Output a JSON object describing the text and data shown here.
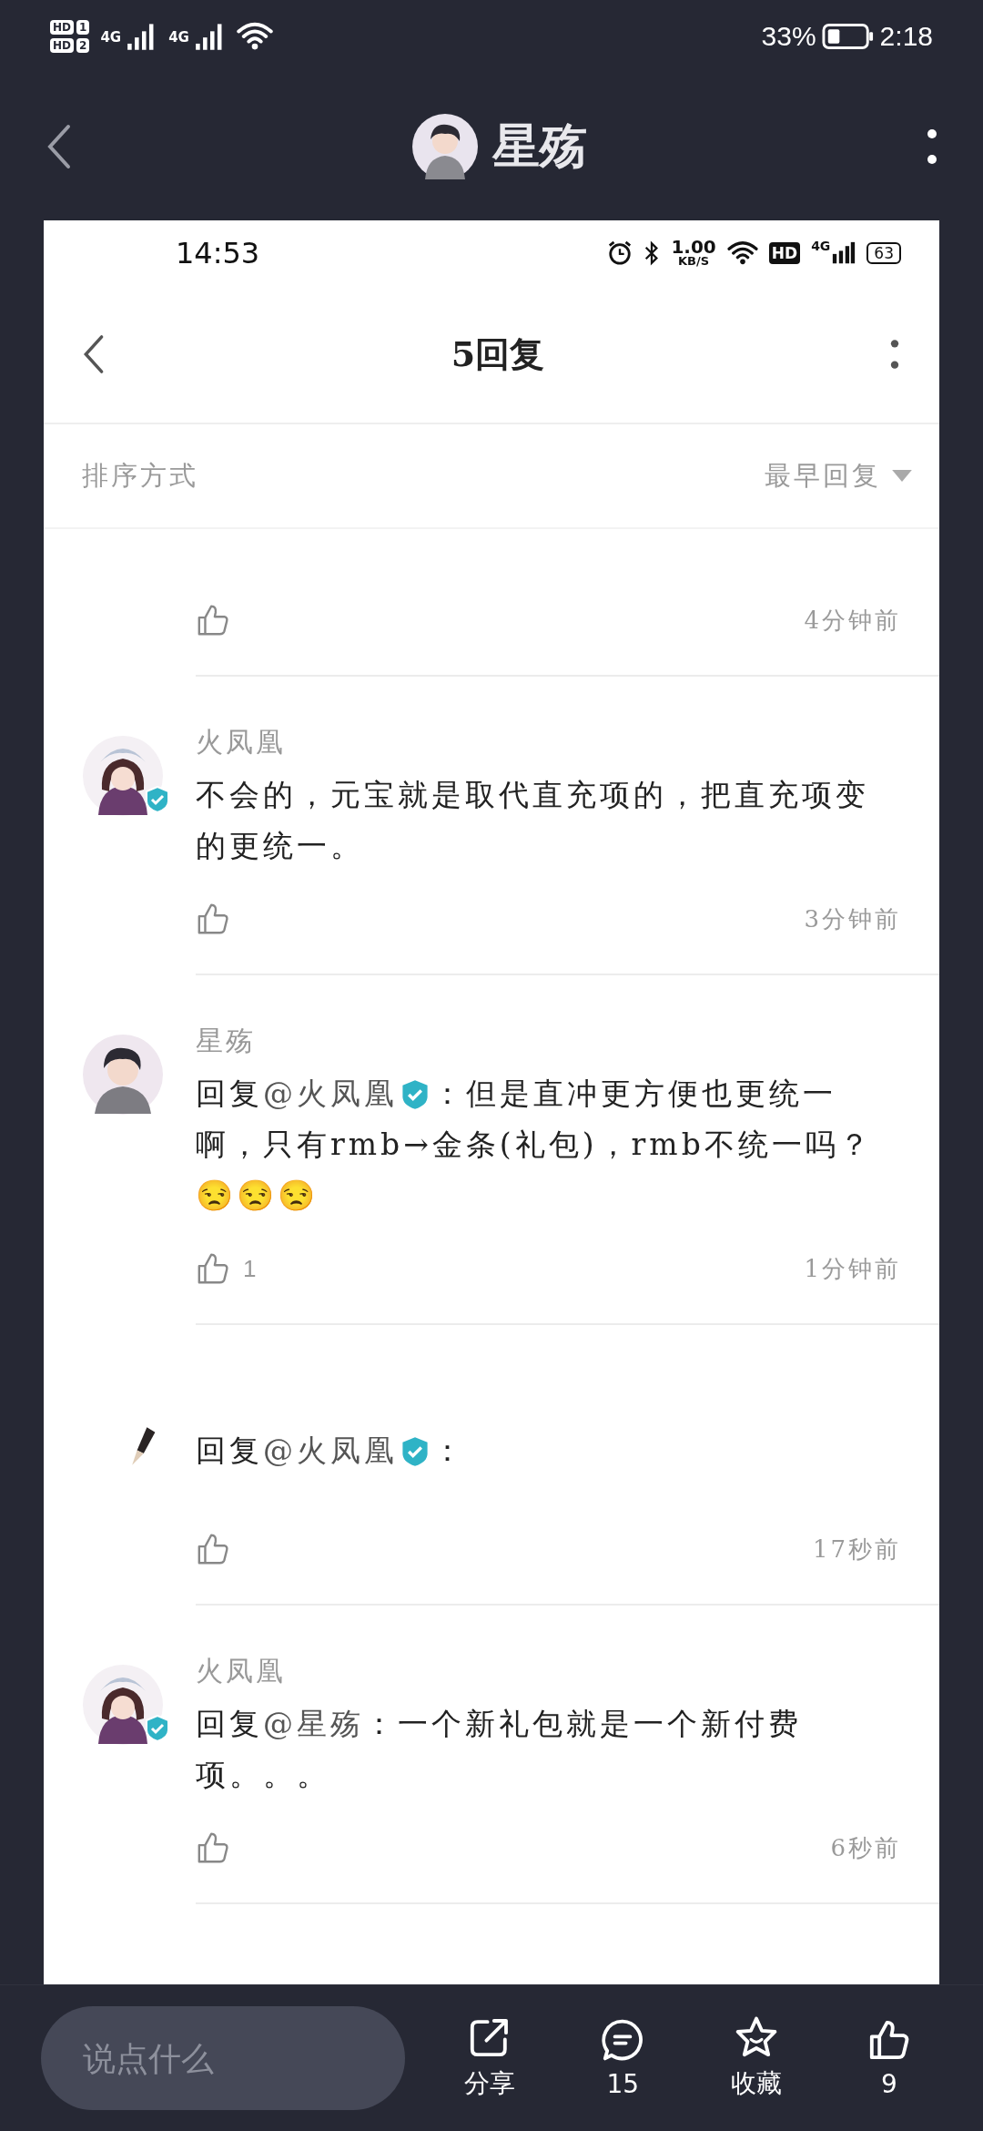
{
  "status_bar": {
    "hd_badges": [
      {
        "label": "HD",
        "sim": "1"
      },
      {
        "label": "HD",
        "sim": "2"
      }
    ],
    "networks": [
      "4G",
      "4G"
    ],
    "battery": "33%",
    "time": "2:18"
  },
  "chat_header": {
    "title": "星殇"
  },
  "shared_screenshot": {
    "status_bar": {
      "time": "14:53",
      "speed": "1.00",
      "speed_unit": "KB/S",
      "hd": "HD",
      "network": "4G",
      "battery": "63"
    },
    "nav": {
      "title": "5回复"
    },
    "sort": {
      "label": "排序方式",
      "value": "最早回复"
    },
    "comments": [
      {
        "time": "4分钟前"
      },
      {
        "avatar": {
          "kind": "girl",
          "verified": true
        },
        "name": "火凤凰",
        "text": "不会的，元宝就是取代直充项的，把直充项变的更统一。",
        "time": "3分钟前"
      },
      {
        "avatar": {
          "kind": "boy"
        },
        "name": "星殇",
        "reply_to": {
          "prefix": "回复",
          "mention": "@火凤凰",
          "verified": true
        },
        "text": "：但是直冲更方便也更统一啊，只有rmb→金条(礼包)，rmb不统一吗？😒😒😒",
        "likes": "1",
        "time": "1分钟前"
      },
      {
        "avatar": {
          "kind": "pen"
        },
        "reply_to": {
          "prefix": "回复",
          "mention": "@火凤凰",
          "verified": true
        },
        "text": "：",
        "time": "17秒前"
      },
      {
        "avatar": {
          "kind": "girl",
          "verified": true
        },
        "name": "火凤凰",
        "reply_to": {
          "prefix": "回复",
          "mention": "@星殇"
        },
        "text": "：一个新礼包就是一个新付费项。。。",
        "time": "6秒前"
      }
    ]
  },
  "bottom_bar": {
    "placeholder": "说点什么",
    "actions": [
      {
        "kind": "share",
        "label": "分享"
      },
      {
        "kind": "comment",
        "label": "15"
      },
      {
        "kind": "collect",
        "label": "收藏"
      },
      {
        "kind": "like",
        "label": "9"
      }
    ]
  }
}
